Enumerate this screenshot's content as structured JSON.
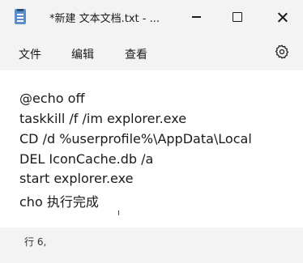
{
  "window": {
    "title": "*新建 文本文档.txt - ..."
  },
  "menu": {
    "file": "文件",
    "edit": "编辑",
    "view": "查看"
  },
  "editor": {
    "lines": [
      "@echo off",
      "taskkill /f /im explorer.exe",
      "CD /d %userprofile%\\AppData\\Local",
      "DEL IconCache.db /a",
      "start explorer.exe",
      "cho 执行完成"
    ]
  },
  "status": {
    "position": "行 6,"
  },
  "icons": {
    "app": "notepad-icon",
    "settings": "gear-icon",
    "minimize": "minimize-icon",
    "maximize": "maximize-icon",
    "close": "close-icon"
  }
}
